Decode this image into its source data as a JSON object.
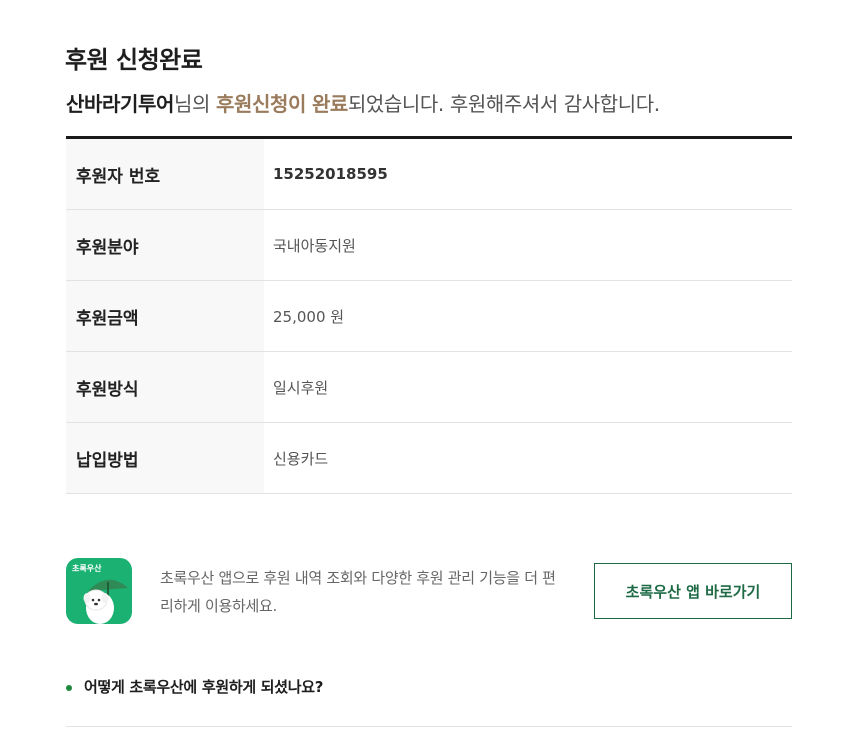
{
  "header": {
    "title": "후원 신청완료",
    "subtitle": {
      "name": "산바라기투어",
      "text1": "님의 ",
      "highlight1": "후원신청이",
      "text2": " ",
      "highlight2": "완료",
      "text3": "되었습니다. 후원해주셔서 감사합니다."
    }
  },
  "donation_info": {
    "rows": [
      {
        "label": "후원자 번호",
        "value": "15252018595"
      },
      {
        "label": "후원분야",
        "value": "국내아동지원"
      },
      {
        "label": "후원금액",
        "value": "25,000 원"
      },
      {
        "label": "후원방식",
        "value": "일시후원"
      },
      {
        "label": "납입방법",
        "value": "신용카드"
      }
    ]
  },
  "app_banner": {
    "icon_label": "초록우산",
    "description": "초록우산 앱으로 후원 내역 조회와 다양한 후원 관리 기능을 더 편리하게 이용하세요.",
    "button_label": "초록우산 앱 바로가기",
    "icon_name": "chorokusan-app-icon",
    "icon_color": "#1bb173",
    "button_color": "#1d6a45"
  },
  "faq": {
    "question": "어떻게 초록우산에 후원하게 되셨나요?",
    "bullet_color": "#1f8a3b"
  }
}
